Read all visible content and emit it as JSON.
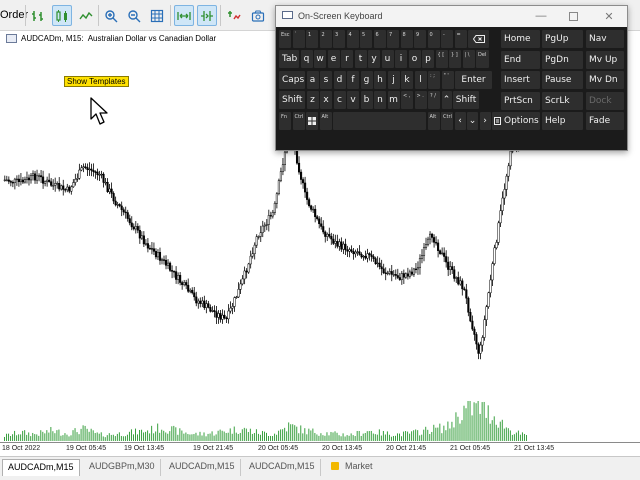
{
  "toolbar": {
    "order_label": "Order",
    "buttons": [
      {
        "icon": "bar-chart-icon",
        "active": false
      },
      {
        "icon": "candlesticks-icon",
        "active": true
      },
      {
        "icon": "line-chart-icon",
        "active": false
      },
      {
        "icon": "zoom-in-icon",
        "active": false
      },
      {
        "icon": "zoom-out-icon",
        "active": false
      },
      {
        "icon": "grid-icon",
        "active": false
      },
      {
        "icon": "auto-scroll-icon",
        "active": true
      },
      {
        "icon": "chart-shift-icon",
        "active": true
      },
      {
        "icon": "indicators-icon",
        "active": false
      },
      {
        "icon": "screenshot-icon",
        "active": false
      }
    ]
  },
  "chart": {
    "symbol": "AUDCADm, M15:",
    "description": "Australian Dollar vs Canadian Dollar",
    "tooltip": "Show Templates",
    "time_labels": [
      "18 Oct 2022",
      "19 Oct 05:45",
      "19 Oct 13:45",
      "19 Oct 21:45",
      "20 Oct 05:45",
      "20 Oct 13:45",
      "20 Oct 21:45",
      "21 Oct 05:45",
      "21 Oct 13:45"
    ],
    "colors": {
      "candle": "#000000",
      "volume": "#3aa040"
    }
  },
  "chart_data": {
    "type": "candlestick",
    "title": "AUDCADm, M15: Australian Dollar vs Canadian Dollar",
    "x_ticks": [
      "18 Oct 2022",
      "19 Oct 05:45",
      "19 Oct 13:45",
      "19 Oct 21:45",
      "20 Oct 05:45",
      "20 Oct 13:45",
      "20 Oct 21:45",
      "21 Oct 05:45",
      "21 Oct 13:45"
    ],
    "price_path": [
      0.8,
      0.79,
      0.815,
      0.78,
      0.76,
      0.85,
      0.82,
      0.72,
      0.64,
      0.56,
      0.5,
      0.43,
      0.36,
      0.32,
      0.28,
      0.42,
      0.6,
      0.68,
      1.0,
      0.74,
      0.62,
      0.56,
      0.54,
      0.52,
      0.46,
      0.44,
      0.47,
      0.6,
      0.48,
      0.4,
      0.15,
      0.55,
      0.92,
      0.96
    ],
    "volume_path": [
      0.15,
      0.25,
      0.2,
      0.3,
      0.22,
      0.35,
      0.18,
      0.2,
      0.25,
      0.3,
      0.4,
      0.28,
      0.2,
      0.22,
      0.3,
      0.35,
      0.25,
      0.2,
      0.45,
      0.3,
      0.25,
      0.2,
      0.18,
      0.3,
      0.22,
      0.2,
      0.25,
      0.35,
      0.4,
      0.9,
      1.0,
      0.7,
      0.3,
      0.15
    ]
  },
  "tabs": [
    {
      "label": "AUDCADm,M15",
      "active": true
    },
    {
      "label": "AUDGBPm,M30",
      "active": false
    },
    {
      "label": "AUDCADm,M15",
      "active": false
    },
    {
      "label": "AUDCADm,M15",
      "active": false
    },
    {
      "label": "Market",
      "active": false,
      "icon": "market-icon"
    }
  ],
  "osk": {
    "title": "On-Screen Keyboard",
    "rows": [
      [
        "Esc",
        "~ `",
        "! 1",
        "@ 2",
        "# 3",
        "$ 4",
        "% 5",
        "^ 6",
        "& 7",
        "* 8",
        "( 9",
        ") 0",
        "_ -",
        "+ ="
      ],
      [
        "Tab",
        "q",
        "w",
        "e",
        "r",
        "t",
        "y",
        "u",
        "i",
        "o",
        "p",
        "{ [",
        "} ]",
        "| \\",
        "Del"
      ],
      [
        "Caps",
        "a",
        "s",
        "d",
        "f",
        "g",
        "h",
        "j",
        "k",
        "l",
        ": ;",
        "\" '",
        "Enter"
      ],
      [
        "Shift",
        "z",
        "x",
        "c",
        "v",
        "b",
        "n",
        "m",
        "< ,",
        "> .",
        "? /",
        "Shift"
      ],
      [
        "Fn",
        "Ctrl",
        "Alt",
        "Alt",
        "Ctrl"
      ]
    ],
    "nav_keys": [
      "Home",
      "PgUp",
      "Nav",
      "End",
      "PgDn",
      "Mv Up",
      "Insert",
      "Pause",
      "Mv Dn",
      "PrtScn",
      "ScrLk",
      "Dock",
      "Options",
      "Help",
      "Fade"
    ]
  }
}
